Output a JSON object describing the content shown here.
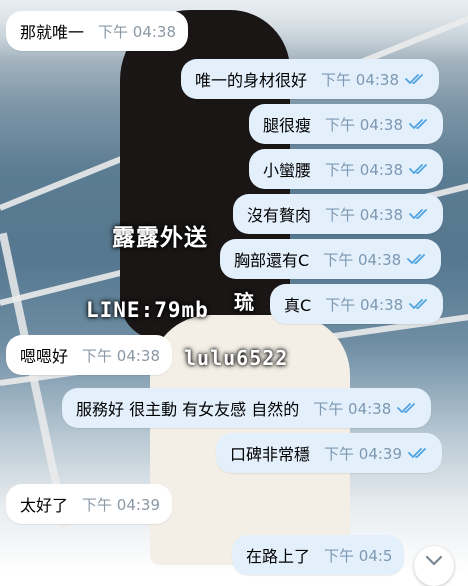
{
  "watermarks": {
    "name": "露露外送",
    "line": "LINE:79mb",
    "id": "lulu6522",
    "side": "琉"
  },
  "messages": [
    {
      "dir": "in",
      "text": "那就唯一",
      "time": "下午 04:38"
    },
    {
      "dir": "out",
      "text": "唯一的身材很好",
      "time": "下午 04:38"
    },
    {
      "dir": "out",
      "text": "腿很瘦",
      "time": "下午 04:38"
    },
    {
      "dir": "out",
      "text": "小蠻腰",
      "time": "下午 04:38"
    },
    {
      "dir": "out",
      "text": "沒有贅肉",
      "time": "下午 04:38"
    },
    {
      "dir": "out",
      "text": "胸部還有C",
      "time": "下午 04:38"
    },
    {
      "dir": "out",
      "text": "真C",
      "time": "下午 04:38"
    },
    {
      "dir": "in",
      "text": "嗯嗯好",
      "time": "下午 04:38"
    },
    {
      "dir": "out",
      "text": "服務好 很主動 有女友感 自然的",
      "time": "下午 04:38"
    },
    {
      "dir": "out",
      "text": "口碑非常穩",
      "time": "下午 04:39"
    },
    {
      "dir": "in",
      "text": "太好了",
      "time": "下午 04:39"
    },
    {
      "dir": "out",
      "text": "在路上了",
      "time": "下午 04:5"
    }
  ],
  "colors": {
    "incoming": "#ffffff",
    "outgoing": "#e3f0fc",
    "check": "#4fa3e0"
  },
  "icons": {
    "read_receipt": "double-check-icon",
    "scroll_down": "chevron-down-icon"
  }
}
